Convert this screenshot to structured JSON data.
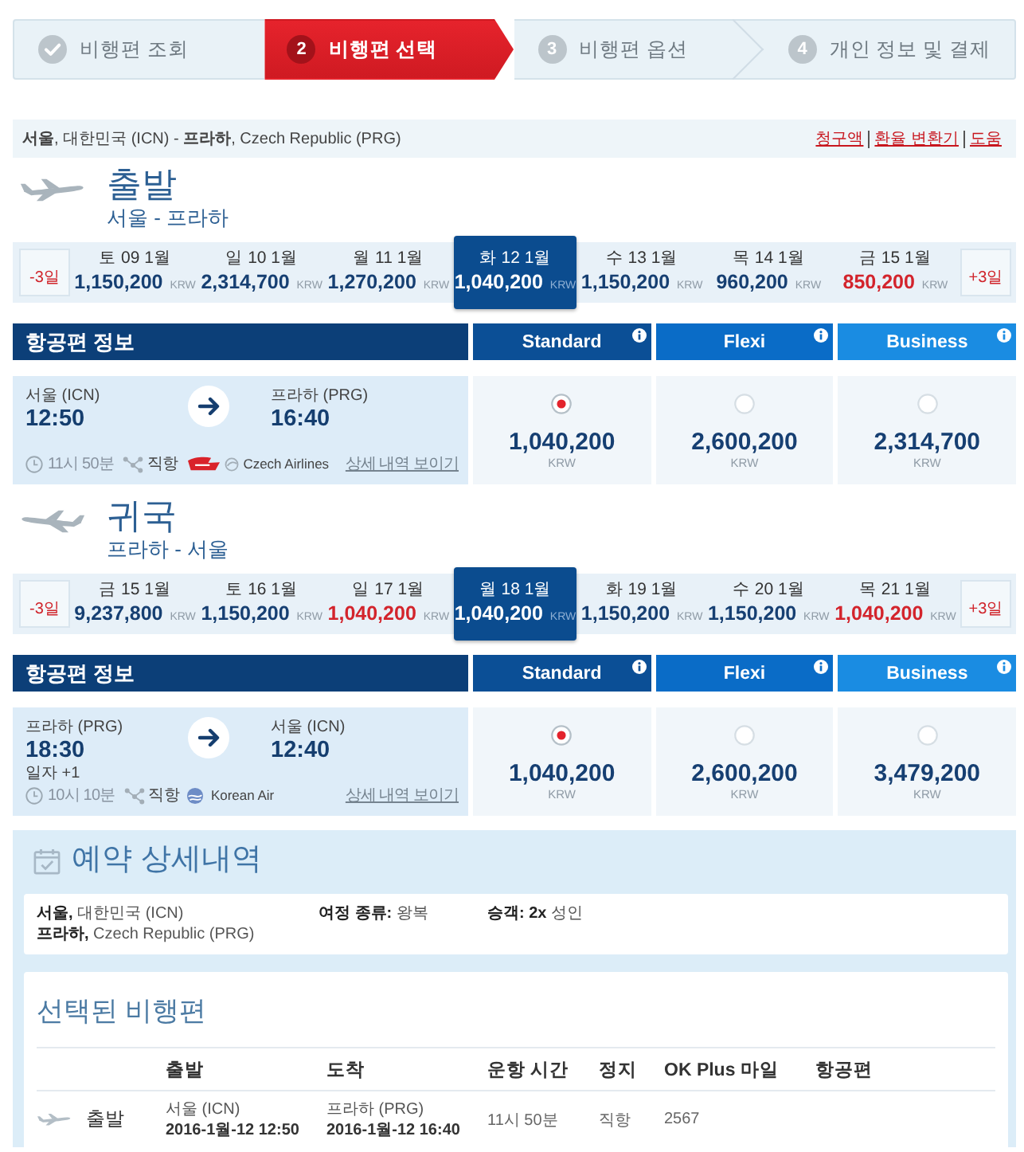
{
  "steps": [
    {
      "label": "비행편 조회",
      "completed": true,
      "selected": false
    },
    {
      "number": "2",
      "label": "비행편 선택",
      "completed": false,
      "selected": true
    },
    {
      "number": "3",
      "label": "비행편 옵션",
      "completed": false,
      "selected": false
    },
    {
      "number": "4",
      "label": "개인 정보 및 결제",
      "completed": false,
      "selected": false
    }
  ],
  "route_bar": {
    "route": "**서울**, 대한민국 (ICN) - **프라하**, Czech Republic (PRG)",
    "links": [
      "청구액",
      "환율 변환기",
      "도움"
    ]
  },
  "journeys": [
    {
      "title": "출발",
      "subtitle": "서울 - 프라하",
      "date_strip": {
        "prev": "-3일",
        "next": "+3일",
        "dates": [
          {
            "day": "토 09 1월",
            "price": "1,150,200",
            "currency": "KRW",
            "selected": false,
            "highlighted": false
          },
          {
            "day": "일 10 1월",
            "price": "2,314,700",
            "currency": "KRW",
            "selected": false,
            "highlighted": false
          },
          {
            "day": "월 11 1월",
            "price": "1,270,200",
            "currency": "KRW",
            "selected": false,
            "highlighted": false
          },
          {
            "day": "화 12 1월",
            "price": "1,040,200",
            "currency": "KRW",
            "selected": true,
            "highlighted": false
          },
          {
            "day": "수 13 1월",
            "price": "1,150,200",
            "currency": "KRW",
            "selected": false,
            "highlighted": false
          },
          {
            "day": "목 14 1월",
            "price": "960,200",
            "currency": "KRW",
            "selected": false,
            "highlighted": false
          },
          {
            "day": "금 15 1월",
            "price": "850,200",
            "currency": "KRW",
            "selected": false,
            "highlighted": true
          }
        ]
      },
      "info_header": "항공편 정보",
      "fare_classes": [
        {
          "name": "Standard",
          "color": "#0b4f96"
        },
        {
          "name": "Flexi",
          "color": "#0a6cc7"
        },
        {
          "name": "Business",
          "color": "#1a8ce2"
        }
      ],
      "flight": {
        "from": "서울 (ICN)",
        "depart": "12:50",
        "to": "프라하 (PRG)",
        "arrive": "16:40",
        "duration": "11시 50분",
        "stops": "직항",
        "airline": "Czech Airlines",
        "details_link": "상세 내역 보이기",
        "fares": [
          {
            "price": "1,040,200",
            "currency": "KRW",
            "selected": true
          },
          {
            "price": "2,600,200",
            "currency": "KRW",
            "selected": false
          },
          {
            "price": "2,314,700",
            "currency": "KRW",
            "selected": false
          }
        ]
      }
    },
    {
      "title": "귀국",
      "subtitle": "프라하 - 서울",
      "date_strip": {
        "prev": "-3일",
        "next": "+3일",
        "dates": [
          {
            "day": "금 15 1월",
            "price": "9,237,800",
            "currency": "KRW",
            "selected": false,
            "highlighted": false
          },
          {
            "day": "토 16 1월",
            "price": "1,150,200",
            "currency": "KRW",
            "selected": false,
            "highlighted": false
          },
          {
            "day": "일 17 1월",
            "price": "1,040,200",
            "currency": "KRW",
            "selected": false,
            "highlighted": true
          },
          {
            "day": "월 18 1월",
            "price": "1,040,200",
            "currency": "KRW",
            "selected": true,
            "highlighted": false
          },
          {
            "day": "화 19 1월",
            "price": "1,150,200",
            "currency": "KRW",
            "selected": false,
            "highlighted": false
          },
          {
            "day": "수 20 1월",
            "price": "1,150,200",
            "currency": "KRW",
            "selected": false,
            "highlighted": false
          },
          {
            "day": "목 21 1월",
            "price": "1,040,200",
            "currency": "KRW",
            "selected": false,
            "highlighted": true
          }
        ]
      },
      "info_header": "항공편 정보",
      "fare_classes": [
        {
          "name": "Standard",
          "color": "#0b4f96"
        },
        {
          "name": "Flexi",
          "color": "#0a6cc7"
        },
        {
          "name": "Business",
          "color": "#1a8ce2"
        }
      ],
      "flight": {
        "from": "프라하 (PRG)",
        "depart": "18:30",
        "date_note": "일자 +1",
        "to": "서울 (ICN)",
        "arrive": "12:40",
        "duration": "10시 10분",
        "stops": "직항",
        "airline": "Korean Air",
        "details_link": "상세 내역 보이기",
        "fares": [
          {
            "price": "1,040,200",
            "currency": "KRW",
            "selected": true
          },
          {
            "price": "2,600,200",
            "currency": "KRW",
            "selected": false
          },
          {
            "price": "3,479,200",
            "currency": "KRW",
            "selected": false
          }
        ]
      }
    }
  ],
  "booking": {
    "title": "예약 상세내역",
    "origin": "**서울,** 대한민국 (ICN)",
    "destination": "**프라하,** Czech Republic (PRG)",
    "trip_type": "**여정 종류:** 왕복",
    "passengers": "**승객: 2x** 성인",
    "selected_flights": {
      "title": "선택된 비행편",
      "columns": [
        "출발",
        "도착",
        "운항 시간",
        "정지",
        "OK Plus 마일",
        "항공편"
      ],
      "rows": [
        {
          "label": "출발",
          "from": "서울 (ICN)",
          "depart": "2016-1월-12 12:50",
          "to": "프라하 (PRG)",
          "arrive": "2016-1월-12 16:40",
          "duration": "11시 50분",
          "stops": "직항",
          "miles": "2567"
        }
      ]
    }
  }
}
